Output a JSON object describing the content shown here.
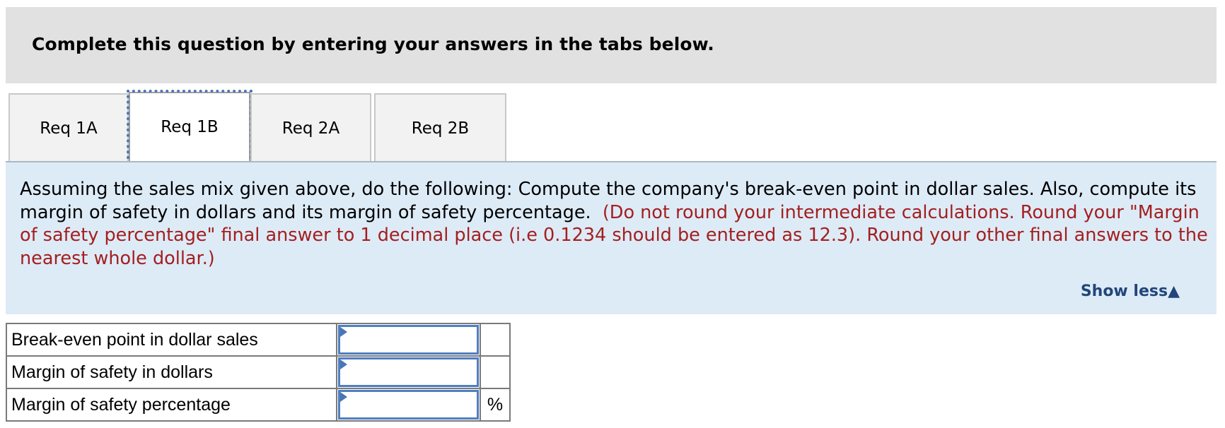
{
  "banner": {
    "title": "Complete this question by entering your answers in the tabs below."
  },
  "tabs": [
    {
      "label": "Req 1A",
      "active": false
    },
    {
      "label": "Req 1B",
      "active": true
    },
    {
      "label": "Req 2A",
      "active": false
    },
    {
      "label": "Req 2B",
      "active": false
    }
  ],
  "panel": {
    "instruction": "Assuming the sales mix given above, do the following: Compute the company's break-even point in dollar sales. Also, compute its margin of safety in dollars and its margin of safety percentage.",
    "note": "(Do not round your intermediate calculations. Round your \"Margin of safety percentage\" final answer to 1 decimal place (i.e 0.1234 should be entered as 12.3).  Round your other final answers to the nearest whole dollar.)",
    "show_less_label": "Show less",
    "show_less_icon": "▲"
  },
  "answers": {
    "rows": [
      {
        "label": "Break-even point in dollar sales",
        "value": "",
        "unit": ""
      },
      {
        "label": "Margin of safety in dollars",
        "value": "",
        "unit": ""
      },
      {
        "label": "Margin of safety percentage",
        "value": "",
        "unit": "%"
      }
    ]
  },
  "colors": {
    "note_red": "#a31f1f",
    "link_blue": "#22467a",
    "panel_bg": "#ddebf7",
    "focus_outline": "#4a76b8"
  }
}
